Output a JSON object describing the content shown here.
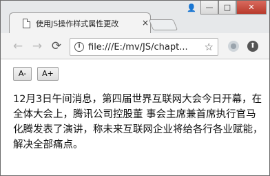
{
  "tab": {
    "title": "使用JS操作样式属性更改",
    "close": "×"
  },
  "window_controls": {
    "user": "👤",
    "minimize": "—",
    "maximize": "□",
    "close": "✕"
  },
  "toolbar": {
    "back": "←",
    "forward": "→",
    "reload": "⟳",
    "url": "file:///E:/mv/JS/chapt...",
    "info": "i",
    "star": "☆",
    "ext_arrow": "⬆"
  },
  "buttons": {
    "decrease": "A-",
    "increase": "A+"
  },
  "article": {
    "text": "12月3日午间消息，第四届世界互联网大会今日开幕，在全体大会上，腾讯公司控股董 事会主席兼首席执行官马化腾发表了演讲，称未来互联网企业将给各行各业赋能，解决全部痛点。"
  }
}
